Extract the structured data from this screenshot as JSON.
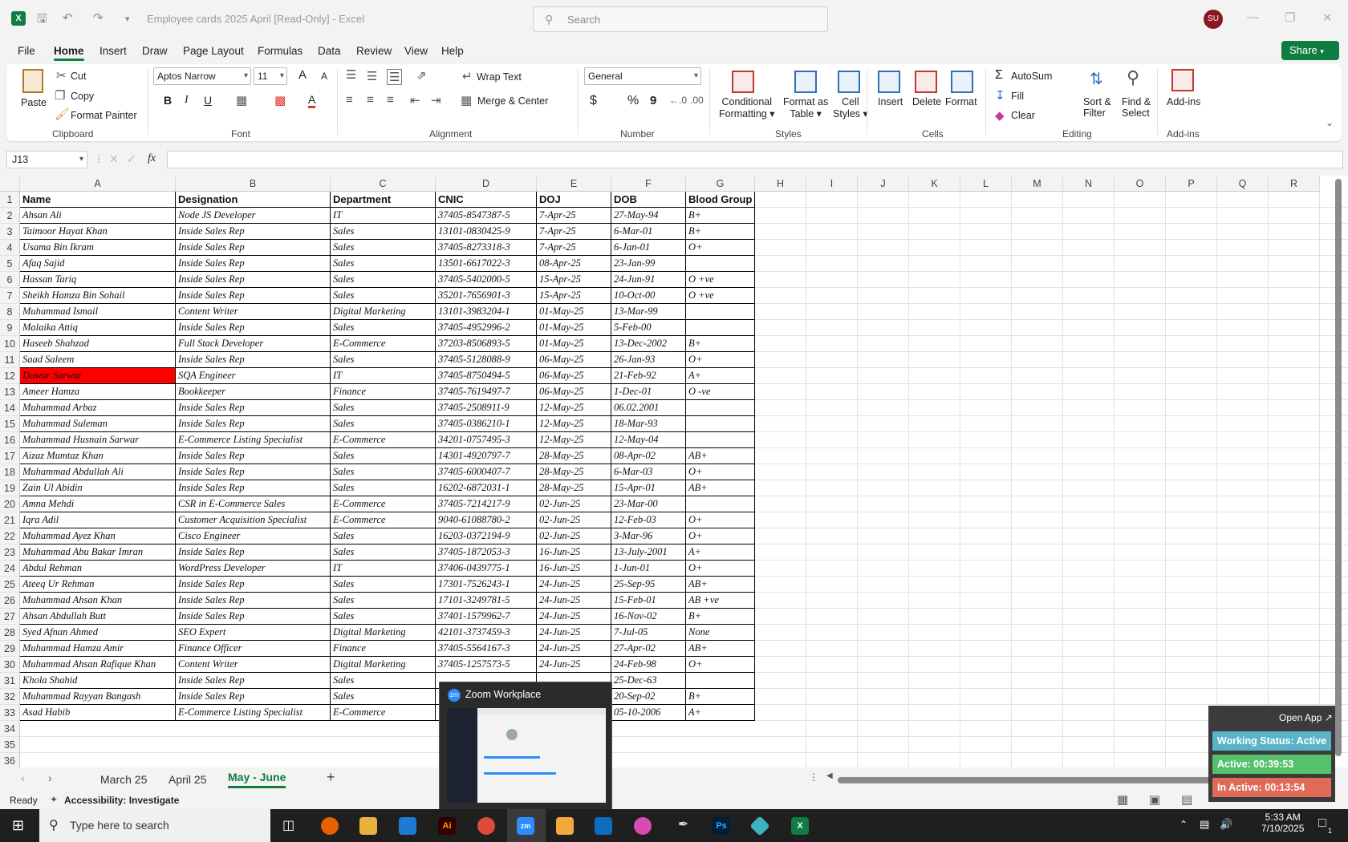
{
  "window": {
    "title": "Employee cards 2025 April  [Read-Only]  -  Excel",
    "search_placeholder": "Search",
    "user_initials": "SU",
    "app_badge": "X"
  },
  "menu": {
    "tabs": [
      "File",
      "Home",
      "Insert",
      "Draw",
      "Page Layout",
      "Formulas",
      "Data",
      "Review",
      "View",
      "Help"
    ],
    "share_label": "Share"
  },
  "ribbon": {
    "clipboard": {
      "paste": "Paste",
      "cut": "Cut",
      "copy": "Copy",
      "format_painter": "Format Painter",
      "group": "Clipboard"
    },
    "font": {
      "family": "Aptos Narrow",
      "size": "11",
      "bold": "B",
      "italic": "I",
      "underline": "U",
      "font_color": "A",
      "grow": "A",
      "shrink": "A",
      "group": "Font"
    },
    "alignment": {
      "wrap": "Wrap Text",
      "merge": "Merge & Center",
      "group": "Alignment"
    },
    "number": {
      "format": "General",
      "currency": "$",
      "percent": "%",
      "comma": "9",
      "group": "Number"
    },
    "styles": {
      "conditional": [
        "Conditional",
        "Formatting"
      ],
      "format_table": [
        "Format as",
        "Table"
      ],
      "cell_styles": [
        "Cell",
        "Styles"
      ],
      "group": "Styles"
    },
    "cells": {
      "insert": "Insert",
      "delete": "Delete",
      "format": "Format",
      "group": "Cells"
    },
    "editing": {
      "autosum": "AutoSum",
      "fill": "Fill",
      "clear": "Clear",
      "sort": [
        "Sort &",
        "Filter"
      ],
      "find": [
        "Find &",
        "Select"
      ],
      "group": "Editing"
    },
    "addins": {
      "label": "Add-ins",
      "group": "Add-ins"
    }
  },
  "formula_bar": {
    "name_box": "J13",
    "fx": "fx",
    "content": ""
  },
  "sheet": {
    "columns": [
      "A",
      "B",
      "C",
      "D",
      "E",
      "F",
      "G",
      "H",
      "I",
      "J",
      "K",
      "L",
      "M",
      "N",
      "O",
      "P",
      "Q",
      "R"
    ],
    "headers": [
      "Name",
      "Designation",
      "Department",
      "CNIC",
      "DOJ",
      "DOB",
      "Blood Group"
    ],
    "rows": [
      [
        " Ahsan Ali",
        "Node JS Developer",
        " IT",
        " 37405-8547387-5",
        "7-Apr-25",
        "27-May-94",
        " B+"
      ],
      [
        " Taimoor Hayat Khan",
        " Inside Sales Rep",
        " Sales",
        " 13101-0830425-9",
        "7-Apr-25",
        "6-Mar-01",
        " B+"
      ],
      [
        " Usama Bin Ikram",
        " Inside Sales Rep",
        " Sales",
        " 37405-8273318-3",
        "7-Apr-25",
        "6-Jan-01",
        " O+"
      ],
      [
        "Afaq Sajid",
        " Inside Sales Rep",
        " Sales",
        " 13501-6617022-3",
        "08-Apr-25",
        "23-Jan-99",
        ""
      ],
      [
        " Hassan Tariq",
        " Inside Sales Rep",
        " Sales",
        " 37405-5402000-5",
        "15-Apr-25",
        "24-Jun-91",
        "O +ve"
      ],
      [
        " Sheikh Hamza Bin Sohail",
        " Inside Sales Rep",
        " Sales",
        " 35201-7656901-3",
        "15-Apr-25",
        "10-Oct-00",
        " O +ve"
      ],
      [
        " Muhammad Ismail",
        " Content Writer",
        " Digital Marketing",
        " 13101-3983204-1",
        "01-May-25",
        "13-Mar-99",
        ""
      ],
      [
        " Malaika Attiq",
        " Inside Sales Rep",
        " Sales",
        " 37405-4952996-2",
        "01-May-25",
        "5-Feb-00",
        ""
      ],
      [
        "Haseeb Shahzad",
        " Full Stack Developer",
        " E-Commerce",
        " 37203-8506893-5",
        "01-May-25",
        "13-Dec-2002",
        " B+"
      ],
      [
        " Saad Saleem",
        " Inside Sales Rep",
        " Sales",
        " 37405-5128088-9",
        "06-May-25",
        "26-Jan-93",
        " O+"
      ],
      [
        " Dawar Sarwar",
        "SQA Engineer",
        "IT",
        "37405-8750494-5",
        "06-May-25",
        "21-Feb-92",
        " A+"
      ],
      [
        " Ameer Hamza",
        "Bookkeeper",
        "Finance",
        "37405-7619497-7",
        "06-May-25",
        "1-Dec-01",
        " O -ve"
      ],
      [
        " Muhammad Arbaz",
        " Inside Sales Rep",
        " Sales",
        " 37405-2508911-9",
        "12-May-25",
        "06.02.2001",
        ""
      ],
      [
        " Muhammad Suleman",
        " Inside Sales Rep",
        " Sales",
        " 37405-0386210-1",
        "12-May-25",
        "18-Mar-93",
        ""
      ],
      [
        " Muhammad Husnain Sarwar",
        " E-Commerce Listing Specialist",
        " E-Commerce",
        " 34201-0757495-3",
        "12-May-25",
        "12-May-04",
        ""
      ],
      [
        " Aizaz Mumtaz Khan",
        " Inside Sales Rep",
        " Sales",
        " 14301-4920797-7",
        "28-May-25",
        "08-Apr-02",
        " AB+"
      ],
      [
        " Muhammad Abdullah Ali",
        " Inside Sales Rep",
        " Sales",
        " 37405-6000407-7",
        "28-May-25",
        "6-Mar-03",
        " O+"
      ],
      [
        " Zain Ul Abidin",
        " Inside Sales Rep",
        " Sales",
        " 16202-6872031-1",
        "28-May-25",
        "15-Apr-01",
        "AB+"
      ],
      [
        "Amna Mehdi",
        " CSR in E-Commerce Sales",
        " E-Commerce",
        " 37405-7214217-9",
        "02-Jun-25",
        "23-Mar-00",
        ""
      ],
      [
        "Iqra Adil",
        "Customer Acquisition Specialist",
        " E-Commerce",
        " 9040-61088780-2",
        "02-Jun-25",
        "12-Feb-03",
        " O+"
      ],
      [
        " Muhammad Ayez Khan",
        " Cisco Engineer",
        " Sales",
        " 16203-0372194-9",
        "02-Jun-25",
        "3-Mar-96",
        " O+"
      ],
      [
        " Muhammad Abu Bakar Imran",
        " Inside Sales Rep",
        " Sales",
        " 37405-1872053-3",
        "16-Jun-25",
        "13-July-2001",
        " A+"
      ],
      [
        "Abdul Rehman",
        " WordPress Developer",
        " IT",
        " 37406-0439775-1",
        "16-Jun-25",
        "1-Jun-01",
        " O+"
      ],
      [
        " Ateeq Ur Rehman",
        " Inside Sales Rep",
        " Sales",
        " 17301-7526243-1",
        "24-Jun-25",
        "25-Sep-95",
        " AB+"
      ],
      [
        " Muhammad Ahsan Khan",
        " Inside Sales Rep",
        " Sales",
        " 17101-3249781-5",
        "24-Jun-25",
        "15-Feb-01",
        " AB +ve"
      ],
      [
        " Ahsan Abdullah Butt",
        " Inside Sales Rep",
        " Sales",
        " 37401-1579962-7",
        "24-Jun-25",
        "16-Nov-02",
        " B+"
      ],
      [
        " Syed Afnan Ahmed",
        " SEO Expert",
        " Digital Marketing",
        " 42101-3737459-3",
        "24-Jun-25",
        "7-Jul-05",
        " None"
      ],
      [
        " Muhammad Hamza Amir",
        "Finance Officer",
        " Finance",
        " 37405-5564167-3",
        "24-Jun-25",
        "27-Apr-02",
        " AB+"
      ],
      [
        "Muhammad Ahsan Rafique Khan",
        " Content Writer",
        " Digital Marketing",
        " 37405-1257573-5",
        "24-Jun-25",
        "24-Feb-98",
        " O+"
      ],
      [
        " Khola Shahid",
        " Inside Sales Rep",
        " Sales",
        "",
        "",
        "25-Dec-63",
        ""
      ],
      [
        " Muhammad Rayyan Bangash",
        " Inside Sales Rep",
        " Sales",
        "",
        "",
        "20-Sep-02",
        " B+"
      ],
      [
        " Asad Habib",
        " E-Commerce Listing Specialist",
        " E-Commerce",
        "",
        "",
        "05-10-2006",
        " A+"
      ]
    ],
    "row_numbers": [
      "1",
      "2",
      "3",
      "4",
      "5",
      "6",
      "7",
      "8",
      "9",
      "10",
      "11",
      "12",
      "13",
      "14",
      "15",
      "16",
      "17",
      "18",
      "19",
      "20",
      "21",
      "22",
      "23",
      "24",
      "25",
      "26",
      "27",
      "28",
      "29",
      "30",
      "31",
      "32",
      "33",
      "34",
      "35",
      "36"
    ],
    "highlight_color": "#ff0000"
  },
  "sheet_tabs": {
    "tabs": [
      "March 25",
      "April 25",
      "May - June"
    ],
    "active": "May - June",
    "add": "+"
  },
  "status": {
    "ready": "Ready",
    "accessibility": "Accessibility: Investigate"
  },
  "zoom_popup": {
    "title": "Zoom Workplace",
    "icon": "zm"
  },
  "tracker": {
    "open_app": "Open App",
    "status": "Working Status: Active",
    "active": "Active: 00:39:53",
    "inactive": "In Active: 00:13:54"
  },
  "taskbar": {
    "search_placeholder": "Type here to search",
    "time": "5:33 AM",
    "date": "7/10/2025",
    "notif_count": "1"
  }
}
